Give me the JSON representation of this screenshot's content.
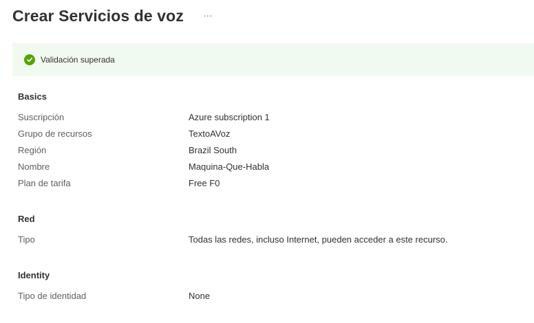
{
  "header": {
    "title": "Crear Servicios de voz",
    "more_label": "···"
  },
  "banner": {
    "icon": "checkmark-circle-icon",
    "status_color": "#57a300",
    "text": "Validación superada"
  },
  "sections": {
    "basics": {
      "heading": "Basics",
      "rows": [
        {
          "label": "Suscripción",
          "value": "Azure subscription 1"
        },
        {
          "label": "Grupo de recursos",
          "value": "TextoAVoz"
        },
        {
          "label": "Región",
          "value": "Brazil South"
        },
        {
          "label": "Nombre",
          "value": "Maquina-Que-Habla"
        },
        {
          "label": "Plan de tarifa",
          "value": "Free F0"
        }
      ]
    },
    "network": {
      "heading": "Red",
      "rows": [
        {
          "label": "Tipo",
          "value": "Todas las redes, incluso Internet, pueden acceder a este recurso."
        }
      ]
    },
    "identity": {
      "heading": "Identity",
      "rows": [
        {
          "label": "Tipo de identidad",
          "value": "None"
        }
      ]
    }
  }
}
